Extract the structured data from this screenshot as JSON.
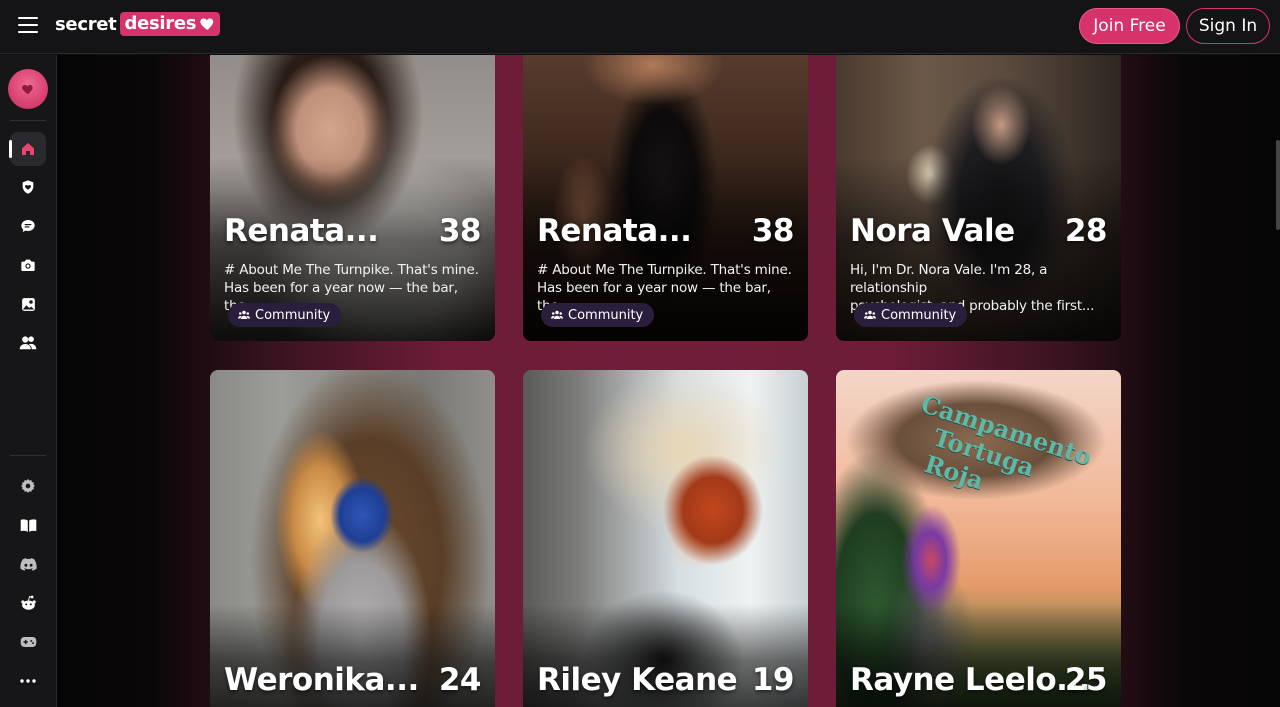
{
  "header": {
    "menu_icon": "hamburger-icon",
    "logo_left": "secret",
    "logo_right": "desires",
    "join_label": "Join Free",
    "signin_label": "Sign In"
  },
  "sidebar": {
    "items": [
      {
        "name": "home",
        "icon": "home-icon",
        "active": true
      },
      {
        "name": "favorites",
        "icon": "heart-shield-icon"
      },
      {
        "name": "chats",
        "icon": "chat-icon"
      },
      {
        "name": "camera",
        "icon": "camera-icon"
      },
      {
        "name": "gallery",
        "icon": "gallery-icon"
      },
      {
        "name": "community",
        "icon": "users-icon"
      }
    ],
    "bottom_items": [
      {
        "name": "settings",
        "icon": "gear-icon"
      },
      {
        "name": "guide",
        "icon": "book-icon"
      },
      {
        "name": "discord",
        "icon": "discord-icon"
      },
      {
        "name": "reddit",
        "icon": "reddit-icon"
      },
      {
        "name": "games",
        "icon": "gamepad-icon"
      },
      {
        "name": "more",
        "icon": "more-icon"
      }
    ]
  },
  "cards": [
    {
      "name": "Renata...",
      "age": "38",
      "desc_line1": "# About Me The Turnpike. That's mine.",
      "desc_line2": "Has been for a year now — the bar, the...",
      "tag": "Community"
    },
    {
      "name": "Renata...",
      "age": "38",
      "desc_line1": "# About Me The Turnpike. That's mine.",
      "desc_line2": "Has been for a year now — the bar, the...",
      "tag": "Community"
    },
    {
      "name": "Nora Vale",
      "age": "28",
      "desc_line1": "Hi, I'm Dr. Nora Vale. I'm 28, a relationship",
      "desc_line2": "psychologist, and probably the first...",
      "tag": "Community"
    },
    {
      "name": "Weronika...",
      "age": "24"
    },
    {
      "name": "Riley Keane",
      "age": "19"
    },
    {
      "name": "Rayne Leelo...",
      "age": "25",
      "sign_line1": "Campamento",
      "sign_line2": "Tortuga Roja"
    }
  ],
  "colors": {
    "accent": "#d6336c",
    "tag_bg": "#2a1e3d"
  }
}
